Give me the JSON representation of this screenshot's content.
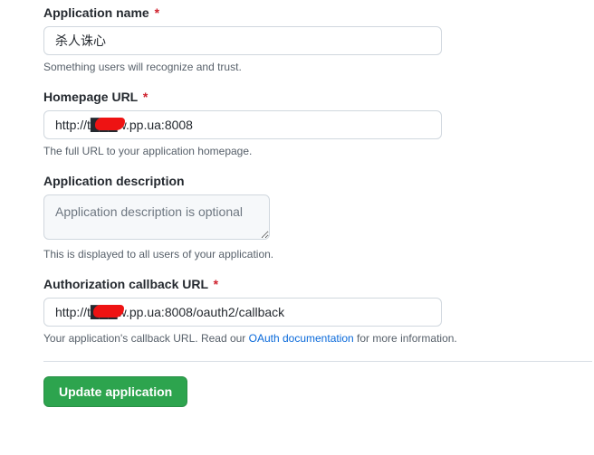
{
  "fields": {
    "app_name": {
      "label": "Application name",
      "value": "杀人诛心",
      "hint": "Something users will recognize and trust.",
      "required": true
    },
    "homepage_url": {
      "label": "Homepage URL",
      "value": "http://t███w.pp.ua:8008",
      "hint": "The full URL to your application homepage.",
      "required": true
    },
    "description": {
      "label": "Application description",
      "value": "",
      "placeholder": "Application description is optional",
      "hint": "This is displayed to all users of your application.",
      "required": false
    },
    "callback_url": {
      "label": "Authorization callback URL",
      "value": "http://t███w.pp.ua:8008/oauth2/callback",
      "hint_before": "Your application's callback URL. Read our ",
      "hint_link": "OAuth documentation",
      "hint_after": " for more information.",
      "required": true
    }
  },
  "button": {
    "update": "Update application"
  }
}
